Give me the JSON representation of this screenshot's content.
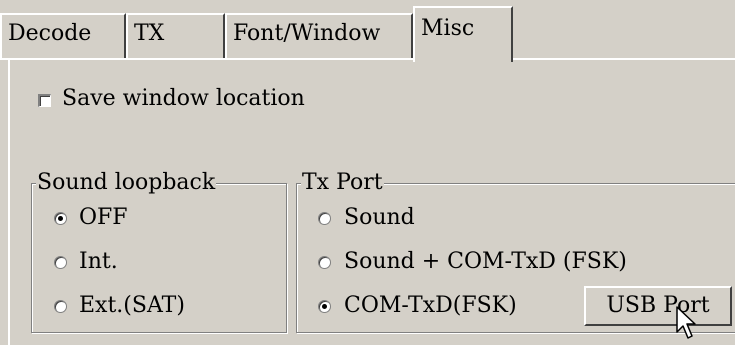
{
  "tabs": [
    {
      "label": "Decode"
    },
    {
      "label": "TX"
    },
    {
      "label": "Font/Window"
    },
    {
      "label": "Misc"
    }
  ],
  "save_window_location": {
    "label": "Save window location",
    "checked": false
  },
  "sound_loopback": {
    "title": "Sound loopback",
    "options": [
      {
        "label": "OFF",
        "selected": true
      },
      {
        "label": "Int.",
        "selected": false
      },
      {
        "label": "Ext.(SAT)",
        "selected": false
      }
    ]
  },
  "tx_port": {
    "title": "Tx Port",
    "options": [
      {
        "label": "Sound",
        "selected": false
      },
      {
        "label": "Sound + COM-TxD (FSK)",
        "selected": false
      },
      {
        "label": "COM-TxD(FSK)",
        "selected": true
      }
    ],
    "usb_button": "USB Port"
  }
}
